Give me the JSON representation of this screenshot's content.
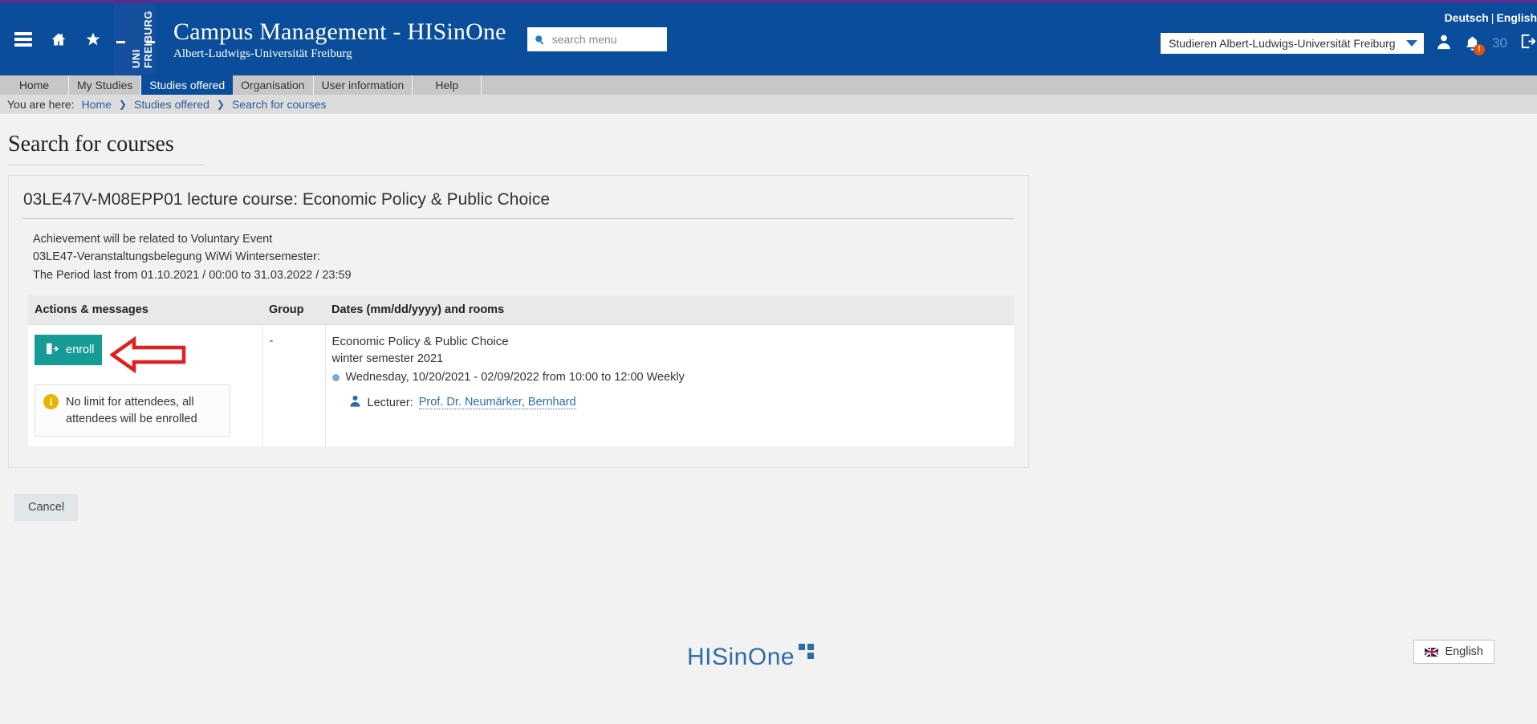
{
  "top": {
    "strip_color": "#5b2d8e"
  },
  "header": {
    "brand_title": "Campus Management - HISinOne",
    "brand_subtitle": "Albert-Ludwigs-Universität Freiburg",
    "logo_line1": "UNI",
    "logo_line2": "FREIBURG",
    "search": {
      "placeholder": "search menu",
      "value": ""
    },
    "languages": {
      "german": "Deutsch",
      "separator": "|",
      "english": "English"
    },
    "org_select": {
      "value": "Studieren Albert-Ludwigs-Universität Freiburg"
    },
    "notification_badge": "!",
    "session_counter": "30",
    "accent_color": "#0a4e9b"
  },
  "nav": {
    "tabs": [
      {
        "label": "Home",
        "active": false
      },
      {
        "label": "My Studies",
        "active": false
      },
      {
        "label": "Studies offered",
        "active": true
      },
      {
        "label": "Organisation",
        "active": false
      },
      {
        "label": "User information",
        "active": false
      },
      {
        "label": "Help",
        "active": false
      }
    ]
  },
  "breadcrumb": {
    "prefix": "You are here:",
    "items": [
      "Home",
      "Studies offered",
      "Search for courses"
    ],
    "separator": "❯"
  },
  "page": {
    "title": "Search for courses"
  },
  "card": {
    "heading": "03LE47V-M08EPP01 lecture course: Economic Policy & Public Choice",
    "description_lines": [
      "Achievement will be related to Voluntary Event",
      "03LE47-Veranstaltungsbelegung WiWi Wintersemester:",
      "The Period last from 01.10.2021 / 00:00 to 31.03.2022 / 23:59"
    ]
  },
  "table": {
    "columns": [
      "Actions & messages",
      "Group",
      "Dates (mm/dd/yyyy) and rooms"
    ],
    "row": {
      "enroll_label": "enroll",
      "info_message": "No limit for attendees, all attendees will be enrolled",
      "group": "-",
      "event_title": "Economic Policy & Public Choice",
      "semester": "winter semester 2021",
      "schedule": "Wednesday, 10/20/2021 - 02/09/2022 from 10:00 to 12:00 Weekly",
      "lecturer_label": "Lecturer:",
      "lecturer_name": "Prof. Dr. Neumärker, Bernhard"
    }
  },
  "actions": {
    "cancel_label": "Cancel"
  },
  "footer": {
    "logo_text": "HISinOne",
    "language_button": "English"
  },
  "colors": {
    "header_blue": "#0a4e9b",
    "enroll_teal": "#169b97",
    "arrow_red": "#e01f1f",
    "info_yellow": "#e8b400",
    "link_blue": "#2a5d9e"
  }
}
